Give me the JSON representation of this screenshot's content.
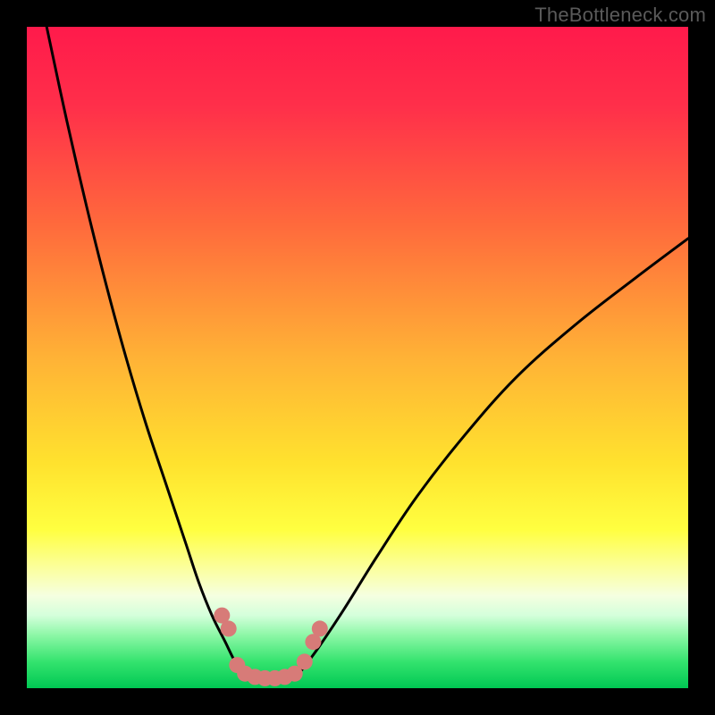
{
  "watermark": "TheBottleneck.com",
  "chart_data": {
    "type": "line",
    "title": "",
    "xlabel": "",
    "ylabel": "",
    "xlim": [
      0,
      100
    ],
    "ylim": [
      0,
      100
    ],
    "background_gradient_stops": [
      {
        "offset": 0.0,
        "color": "#ff1a4b"
      },
      {
        "offset": 0.12,
        "color": "#ff2f4a"
      },
      {
        "offset": 0.3,
        "color": "#ff6a3c"
      },
      {
        "offset": 0.5,
        "color": "#ffb236"
      },
      {
        "offset": 0.66,
        "color": "#ffe22e"
      },
      {
        "offset": 0.76,
        "color": "#ffff40"
      },
      {
        "offset": 0.82,
        "color": "#fbffa0"
      },
      {
        "offset": 0.86,
        "color": "#f5ffe0"
      },
      {
        "offset": 0.89,
        "color": "#d4ffdb"
      },
      {
        "offset": 0.92,
        "color": "#8cf7a6"
      },
      {
        "offset": 0.96,
        "color": "#34e36e"
      },
      {
        "offset": 1.0,
        "color": "#00c853"
      }
    ],
    "series": [
      {
        "name": "curve-left",
        "type": "line",
        "color": "#000000",
        "x": [
          3,
          6,
          9,
          12,
          15,
          18,
          21,
          24,
          26,
          28,
          30,
          31.5,
          33
        ],
        "y": [
          100,
          86,
          73,
          61,
          50,
          40,
          31,
          22,
          16,
          11,
          7,
          4,
          2
        ]
      },
      {
        "name": "curve-right",
        "type": "line",
        "color": "#000000",
        "x": [
          41,
          44,
          48,
          53,
          59,
          66,
          74,
          83,
          92,
          100
        ],
        "y": [
          2,
          6,
          12,
          20,
          29,
          38,
          47,
          55,
          62,
          68
        ]
      },
      {
        "name": "markers",
        "type": "scatter",
        "color": "#d77b78",
        "x": [
          29.5,
          30.5,
          31.8,
          33.0,
          34.5,
          36.0,
          37.5,
          39.0,
          40.5,
          42.0,
          43.3,
          44.3
        ],
        "y": [
          11.0,
          9.0,
          3.5,
          2.2,
          1.7,
          1.5,
          1.5,
          1.7,
          2.2,
          4.0,
          7.0,
          9.0
        ]
      }
    ]
  }
}
